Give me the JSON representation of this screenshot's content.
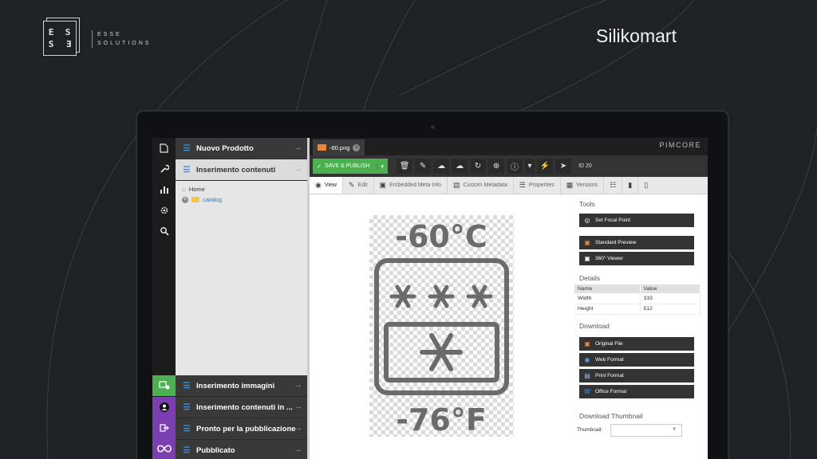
{
  "brand": {
    "logo_letters": [
      "E",
      "S",
      "S",
      "E"
    ],
    "company_line1": "ESSE",
    "company_line2": "SOLUTIONS",
    "page_title": "Silikomart"
  },
  "iconbar": {
    "items": [
      "file-icon",
      "wrench-icon",
      "chart-icon",
      "gear-icon",
      "search-icon"
    ],
    "bottom": [
      {
        "icon": "chat-icon",
        "color": "#4caf50"
      },
      {
        "icon": "user-icon",
        "color": "#7b3fb2"
      },
      {
        "icon": "logout-icon",
        "color": "#7b3fb2"
      },
      {
        "icon": "infinity-icon",
        "color": "#7b3fb2"
      }
    ]
  },
  "tree": {
    "top_navs": [
      "Nuovo Prodotto",
      "Inserimento contenuti"
    ],
    "home_label": "Home",
    "catalog_label": "catalog",
    "bottom_navs": [
      "Inserimento immagini",
      "Inserimento contenuti in ...",
      "Pronto per la pubblicazione",
      "Pubblicato"
    ]
  },
  "editor": {
    "tab_name": "-60.png",
    "brand_text": "PIMCORE",
    "save_label": "SAVE & PUBLISH",
    "id_label": "ID 20",
    "subtabs": [
      "View",
      "Edit",
      "Embedded Meta Info",
      "Custom Metadata",
      "Properties",
      "Versions"
    ],
    "image_text_top": "-60°C",
    "image_text_bottom": "-76°F"
  },
  "side": {
    "tools_heading": "Tools",
    "tools_buttons": [
      "Set Focal Point",
      "Standard Preview",
      "360° Viewer"
    ],
    "details_heading": "Details",
    "details_columns": [
      "Name",
      "Value"
    ],
    "details_rows": [
      {
        "name": "Width",
        "value": "333"
      },
      {
        "name": "Height",
        "value": "512"
      }
    ],
    "download_heading": "Download",
    "download_buttons": [
      "Original File",
      "Web Format",
      "Print Format",
      "Office Format"
    ],
    "thumbnail_heading": "Download Thumbnail",
    "thumbnail_label": "Thumbnail:"
  }
}
